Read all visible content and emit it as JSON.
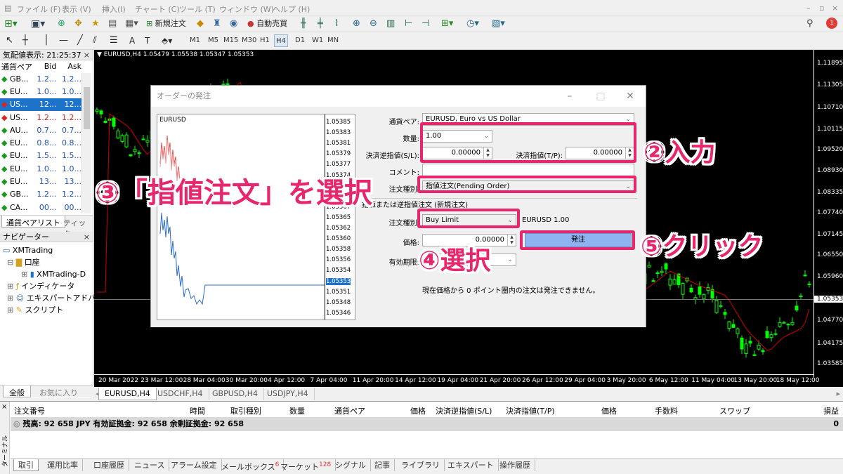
{
  "menu": [
    "ファイル (F)",
    "表示 (V)",
    "挿入(I)",
    "チャート (C)",
    "ツール (T)",
    "ウィンドウ (W)",
    "ヘルプ (H)"
  ],
  "toolbar": {
    "new_order": "新規注文",
    "auto_trade": "自動売買"
  },
  "timeframes": [
    "M1",
    "M5",
    "M15",
    "M30",
    "H1",
    "H4",
    "D1",
    "W1",
    "MN"
  ],
  "active_timeframe": "H4",
  "notification_count": "1",
  "market_watch": {
    "title": "気配値表示: 21:25:37",
    "headers": [
      "通貨ペア",
      "Bid",
      "Ask"
    ],
    "rows": [
      {
        "symbol": "GB...",
        "bid": "1.2...",
        "ask": "1.2...",
        "dir": "up"
      },
      {
        "symbol": "EU...",
        "bid": "1.0...",
        "ask": "1.0...",
        "dir": "up"
      },
      {
        "symbol": "US...",
        "bid": "12...",
        "ask": "12...",
        "dir": "down",
        "selected": true
      },
      {
        "symbol": "US...",
        "bid": "1.2...",
        "ask": "1.2...",
        "dir": "down",
        "red": true
      },
      {
        "symbol": "AU...",
        "bid": "0.7...",
        "ask": "0.7...",
        "dir": "up"
      },
      {
        "symbol": "EU...",
        "bid": "0.8...",
        "ask": "0.8...",
        "dir": "up"
      },
      {
        "symbol": "EU...",
        "bid": "1.5...",
        "ask": "1.5...",
        "dir": "up"
      },
      {
        "symbol": "EU...",
        "bid": "1.0...",
        "ask": "1.0...",
        "dir": "up"
      },
      {
        "symbol": "EU...",
        "bid": "13...",
        "ask": "13...",
        "dir": "up"
      },
      {
        "symbol": "GB...",
        "bid": "1.2...",
        "ask": "1.2...",
        "dir": "up"
      },
      {
        "symbol": "CA...",
        "bid": "00...",
        "ask": "00...",
        "dir": "up"
      }
    ],
    "tabs": [
      "通貨ペアリスト",
      "ティック"
    ]
  },
  "navigator": {
    "title": "ナビゲーター",
    "items": [
      "XMTrading",
      "口座",
      "XMTrading-D",
      "インディケータ",
      "エキスパートアドバイザ",
      "スクリプト"
    ],
    "tabs": [
      "全般",
      "お気に入り"
    ]
  },
  "chart": {
    "header": "EURUSD,H4  1.05479 1.05538 1.05347 1.05353",
    "price_ticks": [
      "1.11895",
      "1.11305",
      "1.10710",
      "1.10115",
      "1.09520",
      "1.08930",
      "1.08335",
      "1.07740",
      "1.07145",
      "1.06550",
      "1.05960",
      "1.05353",
      "1.04770",
      "1.04175",
      "1.03585"
    ],
    "current_price": "1.05353",
    "time_ticks": [
      "20 Mar 2022",
      "23 Mar 12:00",
      "28 Mar 04:00",
      "30 Mar 20:00",
      "4 Apr 12:00",
      "7 Apr 04:00",
      "11 Apr 20:00",
      "14 Apr 12:00",
      "19 Apr 04:00",
      "21 Apr 20:00",
      "26 Apr 12:00",
      "29 Apr 04:00",
      "3 May 20:00",
      "6 May 12:00",
      "11 May 04:00",
      "13 May 20:00",
      "18 May 12:00"
    ],
    "tabs": [
      "EURUSD,H4",
      "USDCHF,H4",
      "GBPUSD,H4",
      "USDJPY,H4"
    ]
  },
  "dialog": {
    "title": "オーダーの発注",
    "mini_symbol": "EURUSD",
    "mini_ticks": [
      "1.05385",
      "1.05383",
      "1.05381",
      "1.05379",
      "1.05377",
      "1.05374",
      "1.05372",
      "1.05369",
      "1.05367",
      "1.05365",
      "1.05362",
      "1.05360",
      "1.05358",
      "1.05356",
      "1.05354",
      "1.05353",
      "1.05351",
      "1.05348",
      "1.05346"
    ],
    "symbol_label": "通貨ペア:",
    "symbol_value": "EURUSD, Euro vs US Dollar",
    "volume_label": "数量:",
    "volume_value": "1.00",
    "sl_label": "決済逆指値(S/L):",
    "sl_value": "0.00000",
    "tp_label": "決済指値(T/P):",
    "tp_value": "0.00000",
    "comment_label": "コメント:",
    "type_label": "注文種別:",
    "type_value": "指値注文(Pending Order)",
    "section_title": "指値または逆指値注文 (新規注文)",
    "order_type_label": "注文種別:",
    "order_type_value": "Buy Limit",
    "order_symbol_info": "EURUSD 1.00",
    "price_label": "価格:",
    "price_value": "0.00000",
    "expiry_label": "有効期限:",
    "submit": "発注",
    "note": "現在価格から 0 ポイント圏内の注文は発注できません。"
  },
  "annotations": {
    "step2": "②入力",
    "step3": "③「指値注文」を選択",
    "step4": "④選択",
    "step5": "⑤クリック"
  },
  "terminal": {
    "side_label": "ターミナル",
    "headers": [
      "注文番号",
      "時間",
      "取引種別",
      "数量",
      "通貨ペア",
      "価格",
      "決済逆指値(S/L)",
      "決済指値(T/P)",
      "価格",
      "手数料",
      "スワップ",
      "損益"
    ],
    "balance_row": "残高: 92 658 JPY  有効証拠金: 92 658  余剰証拠金: 92 658",
    "profit": "0",
    "tabs": [
      "取引",
      "運用比率",
      "口座履歴",
      "ニュース",
      "アラーム設定",
      "メールボックス",
      "マーケット",
      "シグナル",
      "記事",
      "ライブラリ",
      "エキスパート",
      "操作履歴"
    ],
    "mailbox_count": "6",
    "market_count": "128"
  },
  "colors": {
    "accent_pink": "#e8266d",
    "bull_candle": "#00ff00",
    "ma_line": "#cc0000",
    "selection_blue": "#1d73c9",
    "submit_button": "#8db4f0"
  }
}
